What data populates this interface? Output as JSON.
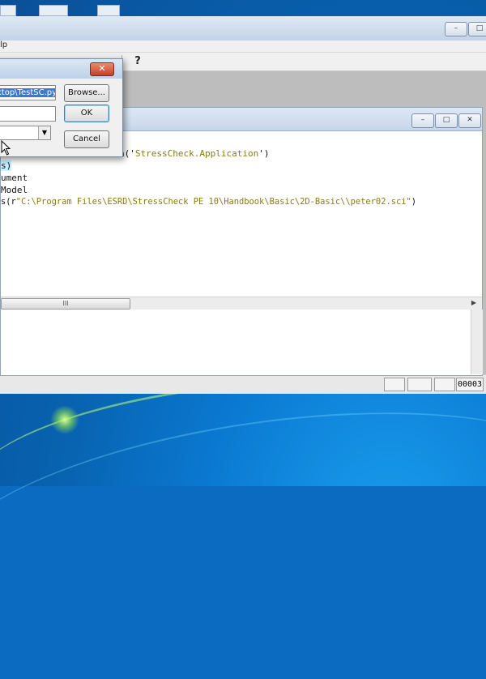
{
  "main_window": {
    "menu_fragment": "lp",
    "help_glyph": "?",
    "controls": {
      "minimize": "–",
      "maximize": "□"
    }
  },
  "status_bar": {
    "panel_value": "00003"
  },
  "code_window": {
    "controls": {
      "minimize": "–",
      "maximize": "□",
      "close": "✕"
    },
    "lines": [
      {
        "pre": "h('",
        "str": "StressCheck.Application",
        "post": "')"
      },
      {
        "pre": "",
        "sel": "s)",
        "post": ""
      },
      {
        "pre": "ument",
        "str": "",
        "post": ""
      },
      {
        "pre": "Model",
        "str": "",
        "post": ""
      },
      {
        "pre": "s(r",
        "str": "\"C:\\Program Files\\ESRD\\StressCheck PE 10\\Handbook\\Basic\\2D-Basic\\\\peter02.sci\"",
        "post": ")"
      }
    ],
    "hscroll_grip": "III",
    "hscroll_arrow": "▶"
  },
  "dialog": {
    "close_glyph": "✕",
    "path_field_value": "ktop\\TestSC.py",
    "second_field_value": "",
    "combo_value": "",
    "combo_arrow": "▼",
    "browse_label": "Browse...",
    "ok_label": "OK",
    "cancel_label": "Cancel"
  },
  "colors": {
    "string_literal": "#8a7a13",
    "selection": "#c8f0ff",
    "dialog_close": "#c2412a"
  },
  "icons": [
    "help-icon",
    "close-icon",
    "minimize-icon",
    "maximize-icon",
    "dropdown-arrow-icon",
    "mouse-cursor-icon"
  ]
}
